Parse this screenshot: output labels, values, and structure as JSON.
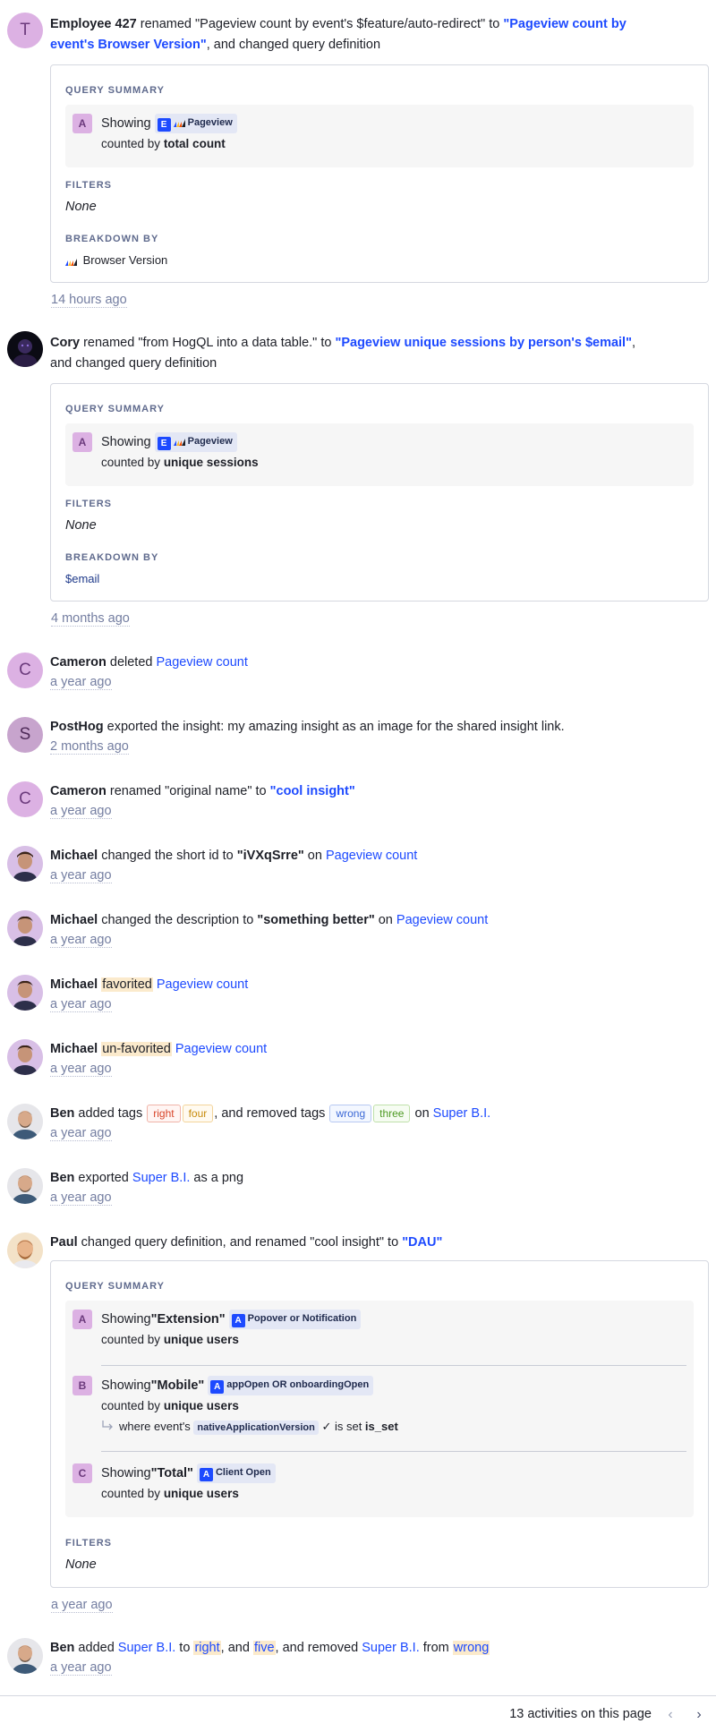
{
  "activities": [
    {
      "user": "Employee 427",
      "avatar_letter": "T",
      "t1": " renamed \"Pageview count by event's $feature/auto-redirect\" to ",
      "new_name": "\"Pageview count by event's Browser Version\"",
      "t2": ",  and changed query definition",
      "card": {
        "summary_title": "QUERY SUMMARY",
        "series": [
          {
            "label": "A",
            "showing": "Showing",
            "event_badge": "E",
            "event": "Pageview",
            "counted_prefix": "counted by ",
            "counted": "total count"
          }
        ],
        "filters_title": "FILTERS",
        "filters_value": "None",
        "breakdown_title": "BREAKDOWN BY",
        "breakdown_value": "Browser Version"
      },
      "time": "14 hours ago"
    },
    {
      "user": "Cory",
      "t1": " renamed \"from HogQL into a data table.\" to ",
      "new_name": "\"Pageview unique sessions by person's $email\"",
      "t2": ",",
      "t3": " and changed query definition",
      "card": {
        "summary_title": "QUERY SUMMARY",
        "series": [
          {
            "label": "A",
            "showing": "Showing",
            "event_badge": "E",
            "event": "Pageview",
            "counted_prefix": "counted by ",
            "counted": "unique sessions"
          }
        ],
        "filters_title": "FILTERS",
        "filters_value": "None",
        "breakdown_title": "BREAKDOWN BY",
        "breakdown_value": "$email"
      },
      "time": "4 months ago"
    },
    {
      "user": "Cameron",
      "avatar_letter": "C",
      "t1": " deleted ",
      "link": "Pageview count",
      "time": "a year ago"
    },
    {
      "user": "PostHog",
      "avatar_letter": "S",
      "t1": " exported the insight: my amazing insight as an image for the shared insight link.",
      "time": "2 months ago"
    },
    {
      "user": "Cameron",
      "avatar_letter": "C",
      "t1": " renamed \"original name\" to ",
      "new_name": "\"cool insight\"",
      "time": "a year ago"
    },
    {
      "user": "Michael",
      "t1": " changed the short id to ",
      "value": "\"iVXqSrre\"",
      "t2": " on ",
      "link": "Pageview count",
      "time": "a year ago"
    },
    {
      "user": "Michael",
      "t1": " changed the description to ",
      "value": "\"something better\"",
      "t2": " on ",
      "link": "Pageview count",
      "time": "a year ago"
    },
    {
      "user": "Michael",
      "mark": "favorited",
      "link": "Pageview count",
      "time": "a year ago"
    },
    {
      "user": "Michael",
      "mark": "un-favorited",
      "link": "Pageview count",
      "time": "a year ago"
    },
    {
      "user": "Ben",
      "t1": " added tags ",
      "added_tags": [
        "right",
        "four"
      ],
      "t2": ",  and removed tags ",
      "removed_tags": [
        "wrong",
        "three"
      ],
      "t3": " on ",
      "link": "Super B.I.",
      "time": "a year ago"
    },
    {
      "user": "Ben",
      "t1": " exported ",
      "link": "Super B.I.",
      "t2": " as a png",
      "time": "a year ago"
    },
    {
      "user": "Paul",
      "t1": " changed query definition,  and renamed \"cool insight\" to ",
      "new_name": "\"DAU\"",
      "card": {
        "summary_title": "QUERY SUMMARY",
        "series": [
          {
            "label": "A",
            "showing": "Showing",
            "name": "\"Extension\"",
            "event_badge": "A",
            "event": "Popover or Notification",
            "counted_prefix": "counted by ",
            "counted": "unique users"
          },
          {
            "label": "B",
            "showing": "Showing",
            "name": "\"Mobile\"",
            "event_badge": "A",
            "event": "appOpen OR onboardingOpen",
            "counted_prefix": "counted by ",
            "counted": "unique users",
            "where_prefix": "where event's ",
            "where_prop": "nativeApplicationVersion",
            "where_op": " ✓ is set ",
            "where_value": "is_set"
          },
          {
            "label": "C",
            "showing": "Showing",
            "name": "\"Total\"",
            "event_badge": "A",
            "event": "Client Open",
            "counted_prefix": "counted by ",
            "counted": "unique users"
          }
        ],
        "filters_title": "FILTERS",
        "filters_value": "None"
      },
      "time": "a year ago"
    },
    {
      "user": "Ben",
      "t1": " added ",
      "link": "Super B.I.",
      "t2": " to ",
      "mark1": "right",
      "t3": ",  and ",
      "mark2": "five",
      "t4": ",  and removed ",
      "link2": "Super B.I.",
      "t5": " from ",
      "mark3": "wrong",
      "time": "a year ago"
    }
  ],
  "footer": {
    "count_text": "13 activities on this page",
    "prev_icon": "‹",
    "next_icon": "›"
  },
  "colors": {
    "accent": "#1d4aff",
    "avatar_purple": "#dcb1e3",
    "highlight": "#fbeacc"
  }
}
